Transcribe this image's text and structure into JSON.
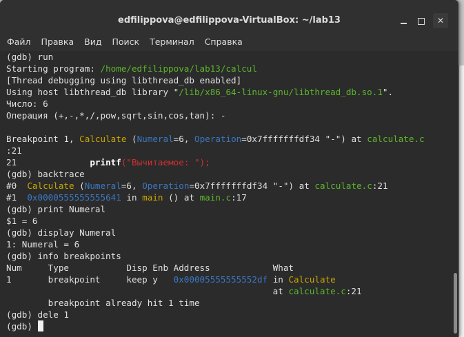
{
  "window": {
    "title": "edfilippova@edfilippova-VirtualBox: ~/lab13"
  },
  "menu": [
    "Файл",
    "Правка",
    "Вид",
    "Поиск",
    "Терминал",
    "Справка"
  ],
  "terminal": {
    "lines": [
      [
        {
          "t": "(gdb) run"
        }
      ],
      [
        {
          "t": "Starting program: "
        },
        {
          "t": "/home/edfilippova/lab13/calcul",
          "c": "g"
        }
      ],
      [
        {
          "t": "[Thread debugging using libthread_db enabled]"
        }
      ],
      [
        {
          "t": "Using host libthread_db library \""
        },
        {
          "t": "/lib/x86_64-linux-gnu/libthread_db.so.1",
          "c": "g"
        },
        {
          "t": "\"."
        }
      ],
      [
        {
          "t": "Число: 6"
        }
      ],
      [
        {
          "t": "Операция (+,-,*,/,pow,sqrt,sin,cos,tan): -"
        }
      ],
      [
        {
          "t": ""
        }
      ],
      [
        {
          "t": "Breakpoint 1, "
        },
        {
          "t": "Calculate",
          "c": "y"
        },
        {
          "t": " ("
        },
        {
          "t": "Numeral",
          "c": "b"
        },
        {
          "t": "=6, "
        },
        {
          "t": "Operation",
          "c": "b"
        },
        {
          "t": "=0x7fffffffdf34 \"-\") at "
        },
        {
          "t": "calculate.c",
          "c": "g"
        }
      ],
      [
        {
          "t": ":21"
        }
      ],
      [
        {
          "t": "21\t\t"
        },
        {
          "t": "printf",
          "c": "bold"
        },
        {
          "t": "(\"Вычитаемое: \");",
          "c": "r"
        }
      ],
      [
        {
          "t": "(gdb) backtrace"
        }
      ],
      [
        {
          "t": "#0  "
        },
        {
          "t": "Calculate",
          "c": "y"
        },
        {
          "t": " ("
        },
        {
          "t": "Numeral",
          "c": "b"
        },
        {
          "t": "=6, "
        },
        {
          "t": "Operation",
          "c": "b"
        },
        {
          "t": "=0x7fffffffdf34 \"-\") at "
        },
        {
          "t": "calculate.c",
          "c": "g"
        },
        {
          "t": ":21"
        }
      ],
      [
        {
          "t": "#1  "
        },
        {
          "t": "0x0000555555555641",
          "c": "b"
        },
        {
          "t": " in "
        },
        {
          "t": "main",
          "c": "y"
        },
        {
          "t": " () at "
        },
        {
          "t": "main.c",
          "c": "g"
        },
        {
          "t": ":17"
        }
      ],
      [
        {
          "t": "(gdb) print Numeral"
        }
      ],
      [
        {
          "t": "$1 = 6"
        }
      ],
      [
        {
          "t": "(gdb) display Numeral"
        }
      ],
      [
        {
          "t": "1: Numeral = 6"
        }
      ],
      [
        {
          "t": "(gdb) info breakpoints"
        }
      ],
      [
        {
          "t": "Num     Type           Disp Enb Address            What"
        }
      ],
      [
        {
          "t": "1       breakpoint     keep y   "
        },
        {
          "t": "0x00005555555552df",
          "c": "b"
        },
        {
          "t": " in "
        },
        {
          "t": "Calculate",
          "c": "y"
        }
      ],
      [
        {
          "t": "                                                   at "
        },
        {
          "t": "calculate.c",
          "c": "g"
        },
        {
          "t": ":21"
        }
      ],
      [
        {
          "t": "\tbreakpoint already hit 1 time"
        }
      ],
      [
        {
          "t": "(gdb) dele 1"
        }
      ],
      [
        {
          "t": "(gdb) "
        },
        {
          "t": "",
          "c": "cursor"
        }
      ]
    ]
  }
}
